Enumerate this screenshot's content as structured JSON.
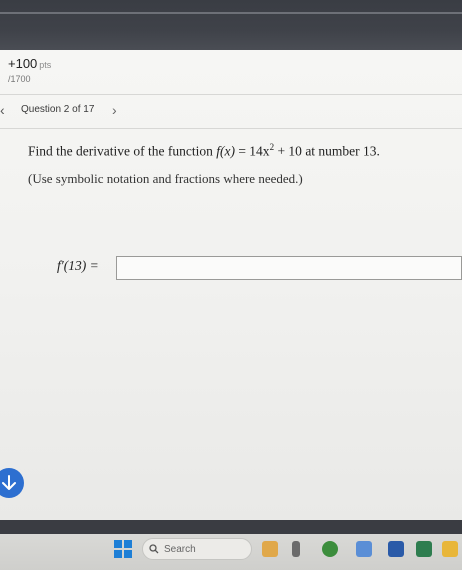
{
  "score": {
    "value": "+100",
    "unit": "pts",
    "total": "/1700"
  },
  "question": {
    "label": "Question 2 of 17",
    "prompt_text": "Find the derivative of the function",
    "function_lhs": "f(x)",
    "function_rhs_coeff": "= 14x",
    "function_exp": "2",
    "function_rest": " + 10",
    "prompt_tail": "at number 13.",
    "hint": "(Use symbolic notation and fractions where needed.)",
    "answer_label": "f′(13) =",
    "answer_value": ""
  },
  "taskbar": {
    "search_label": "Search"
  },
  "colors": {
    "accent": "#2d6fd0",
    "windows_blue": "#1e7fd6"
  },
  "icons": {
    "nav_prev": "chevron-left-icon",
    "nav_next": "chevron-right-icon",
    "scroll_down": "arrow-down-icon",
    "start": "windows-icon",
    "search": "search-icon"
  }
}
